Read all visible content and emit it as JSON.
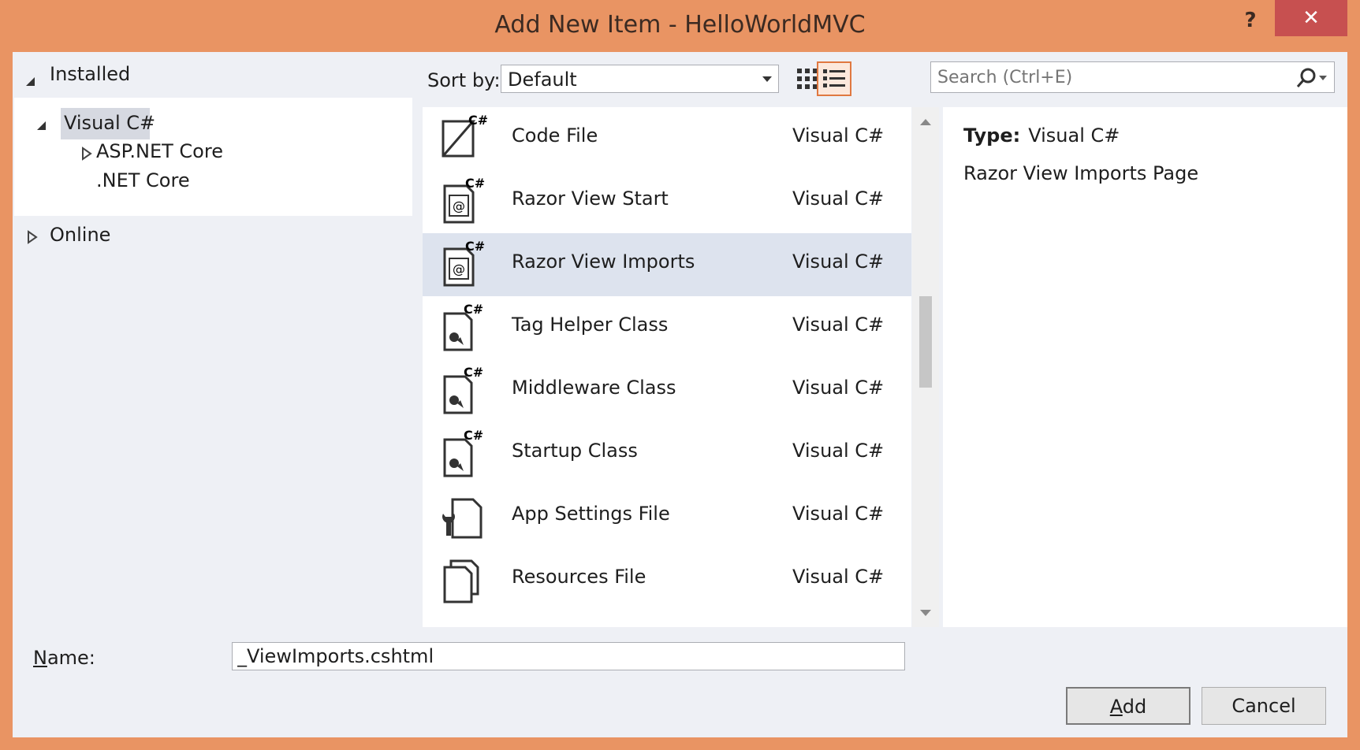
{
  "window": {
    "title": "Add New Item - HelloWorldMVC",
    "help_glyph": "?",
    "close_glyph": "✕"
  },
  "left": {
    "installed": "Installed",
    "tree": {
      "visual_cs": "Visual C#",
      "aspnet_core": "ASP.NET Core",
      "net_core": ".NET Core"
    },
    "online": "Online"
  },
  "toolbar": {
    "sort_label": "Sort by:",
    "sort_value": "Default",
    "search_placeholder": "Search (Ctrl+E)"
  },
  "templates": [
    {
      "name": "Code File",
      "lang": "Visual C#",
      "icon": "code-file-icon"
    },
    {
      "name": "Razor View Start",
      "lang": "Visual C#",
      "icon": "razor-file-icon"
    },
    {
      "name": "Razor View Imports",
      "lang": "Visual C#",
      "icon": "razor-file-icon",
      "selected": true
    },
    {
      "name": "Tag Helper Class",
      "lang": "Visual C#",
      "icon": "class-file-icon"
    },
    {
      "name": "Middleware Class",
      "lang": "Visual C#",
      "icon": "class-file-icon"
    },
    {
      "name": "Startup Class",
      "lang": "Visual C#",
      "icon": "class-file-icon"
    },
    {
      "name": "App Settings File",
      "lang": "Visual C#",
      "icon": "settings-file-icon"
    },
    {
      "name": "Resources File",
      "lang": "Visual C#",
      "icon": "resources-file-icon"
    }
  ],
  "details": {
    "type_label": "Type:",
    "type_value": "Visual C#",
    "description": "Razor View Imports Page"
  },
  "bottom": {
    "name_label": "Name:",
    "name_value": "_ViewImports.cshtml",
    "add_label": "Add",
    "cancel_label": "Cancel"
  }
}
